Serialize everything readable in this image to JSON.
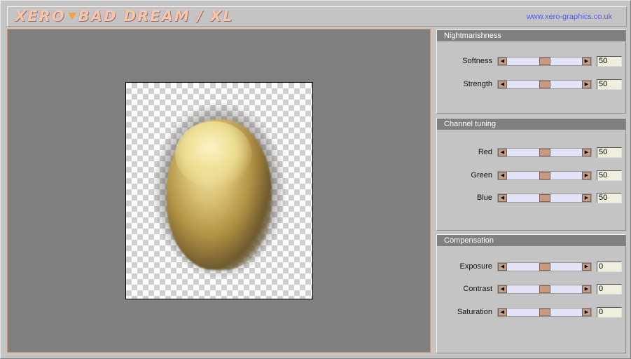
{
  "header": {
    "logo_left": "XERO",
    "logo_right": "BAD DREAM / XL",
    "site_link": "www.xero-graphics.co.uk"
  },
  "colors": {
    "accent": "#c89a80",
    "panel_header": "#808080",
    "preview_bg": "#808080",
    "link": "#5a5ae6"
  },
  "panels": [
    {
      "title": "Nightmarishness",
      "controls": [
        {
          "label": "Softness",
          "value": "50",
          "level": 0.5
        },
        {
          "label": "Strength",
          "value": "50",
          "level": 0.5
        }
      ]
    },
    {
      "title": "Channel tuning",
      "controls": [
        {
          "label": "Red",
          "value": "50",
          "level": 0.5
        },
        {
          "label": "Green",
          "value": "50",
          "level": 0.5
        },
        {
          "label": "Blue",
          "value": "50",
          "level": 0.5
        }
      ]
    },
    {
      "title": "Compensation",
      "controls": [
        {
          "label": "Exposure",
          "value": "0",
          "level": 0.5
        },
        {
          "label": "Contrast",
          "value": "0",
          "level": 0.5
        },
        {
          "label": "Saturation",
          "value": "0",
          "level": 0.5
        }
      ]
    }
  ],
  "icons": {
    "left_arrow": "arrow-left-icon",
    "right_arrow": "arrow-right-icon"
  }
}
